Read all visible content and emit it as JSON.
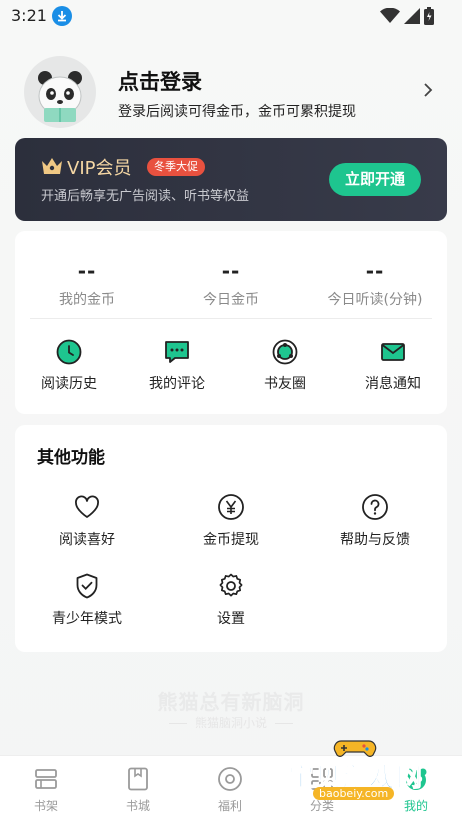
{
  "status_bar": {
    "time": "3:21"
  },
  "profile": {
    "title": "点击登录",
    "subtitle": "登录后阅读可得金币，金币可累积提现"
  },
  "vip": {
    "title": "VIP会员",
    "badge": "冬季大促",
    "description": "开通后畅享无广告阅读、听书等权益",
    "button": "立即开通",
    "colors": {
      "accent": "#1ec58f",
      "gold": "#f5d7a4",
      "badge": "#e8513f"
    }
  },
  "stats": [
    {
      "value": "--",
      "label": "我的金币"
    },
    {
      "value": "--",
      "label": "今日金币"
    },
    {
      "value": "--",
      "label": "今日听读(分钟)"
    }
  ],
  "quick_actions": [
    {
      "label": "阅读历史",
      "icon": "clock-icon"
    },
    {
      "label": "我的评论",
      "icon": "comment-icon"
    },
    {
      "label": "书友圈",
      "icon": "circle-icon"
    },
    {
      "label": "消息通知",
      "icon": "mail-icon"
    }
  ],
  "other": {
    "title": "其他功能",
    "items": [
      {
        "label": "阅读喜好",
        "icon": "heart-icon"
      },
      {
        "label": "金币提现",
        "icon": "yen-icon"
      },
      {
        "label": "帮助与反馈",
        "icon": "question-icon"
      },
      {
        "label": "青少年模式",
        "icon": "shield-check-icon"
      },
      {
        "label": "设置",
        "icon": "gear-icon"
      }
    ]
  },
  "slogan": {
    "main": "熊猫总有新脑洞",
    "sub": "熊猫脑洞小说"
  },
  "tabs": [
    {
      "label": "书架",
      "icon": "bookshelf-icon",
      "active": false
    },
    {
      "label": "书城",
      "icon": "book-icon",
      "active": false
    },
    {
      "label": "福利",
      "icon": "coin-icon",
      "active": false
    },
    {
      "label": "分类",
      "icon": "category-icon",
      "active": false
    },
    {
      "label": "我的",
      "icon": "panda-icon",
      "active": true
    }
  ],
  "watermark": {
    "text": "宝贝游戏网",
    "url": "baobeiy.com"
  }
}
